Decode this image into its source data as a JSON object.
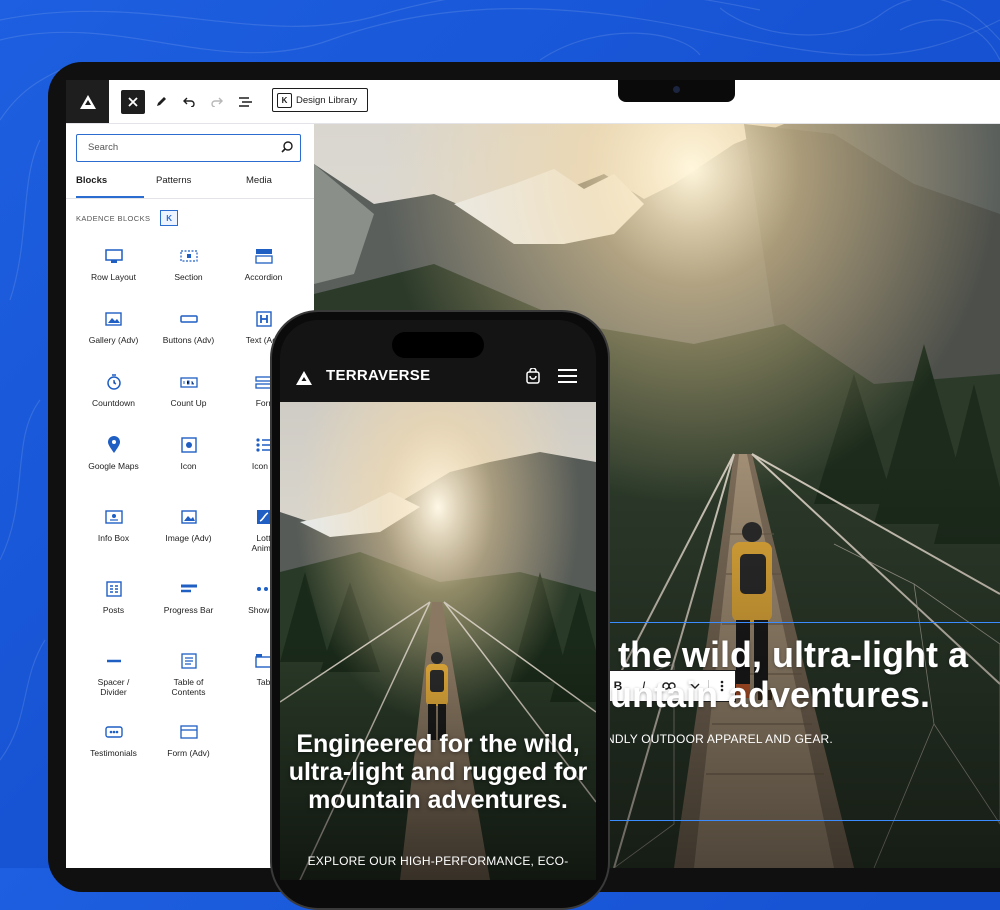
{
  "toolbar": {
    "design_library_label": "Design Library"
  },
  "inserter": {
    "search_placeholder": "Search",
    "tabs": [
      {
        "label": "Blocks",
        "active": true
      },
      {
        "label": "Patterns",
        "active": false
      },
      {
        "label": "Media",
        "active": false
      }
    ],
    "section_label": "KADENCE BLOCKS",
    "blocks": [
      {
        "label": "Row Layout",
        "icon": "row-layout-icon"
      },
      {
        "label": "Section",
        "icon": "section-icon"
      },
      {
        "label": "Accordion",
        "icon": "accordion-icon"
      },
      {
        "label": "Gallery (Adv)",
        "icon": "gallery-icon"
      },
      {
        "label": "Buttons (Adv)",
        "icon": "buttons-icon"
      },
      {
        "label": "Text (Adv",
        "icon": "text-h-icon"
      },
      {
        "label": "Countdown",
        "icon": "countdown-icon"
      },
      {
        "label": "Count Up",
        "icon": "count-up-icon"
      },
      {
        "label": "Forr",
        "icon": "form-icon"
      },
      {
        "label": "Google Maps",
        "icon": "map-pin-icon"
      },
      {
        "label": "Icon",
        "icon": "icon-block-icon"
      },
      {
        "label": "Icon L",
        "icon": "icon-list-icon"
      },
      {
        "label": "Info Box",
        "icon": "info-box-icon"
      },
      {
        "label": "Image (Adv)",
        "icon": "image-icon"
      },
      {
        "label": "Lott\nAnima",
        "icon": "lottie-icon"
      },
      {
        "label": "Posts",
        "icon": "posts-icon"
      },
      {
        "label": "Progress Bar",
        "icon": "progress-bar-icon"
      },
      {
        "label": "Show M",
        "icon": "show-more-icon"
      },
      {
        "label": "Spacer /\nDivider",
        "icon": "spacer-icon"
      },
      {
        "label": "Table of\nContents",
        "icon": "toc-icon"
      },
      {
        "label": "Tab",
        "icon": "tabs-icon"
      },
      {
        "label": "Testimonials",
        "icon": "testimonials-icon"
      },
      {
        "label": "Form (Adv)",
        "icon": "form-adv-icon"
      }
    ]
  },
  "canvas": {
    "heading_line1": "the wild, ultra-light a",
    "heading_line2": "untain adventures.",
    "subtext": "NDLY OUTDOOR APPAREL AND GEAR."
  },
  "block_toolbar": {
    "bold": "B",
    "italic": "I",
    "link": "⊖",
    "more": "⌄",
    "options": "⋮"
  },
  "phone": {
    "brand": "TERRAVERSE",
    "heading": "Engineered for the wild, ultra-light and rugged for mountain adventures.",
    "subtext": "EXPLORE OUR HIGH-PERFORMANCE, ECO-"
  },
  "colors": {
    "background_blue": "#1a58d8",
    "accent_blue": "#2b6cd0",
    "selection_blue": "#3b8cff",
    "editor_dark": "#1e1e1e"
  }
}
